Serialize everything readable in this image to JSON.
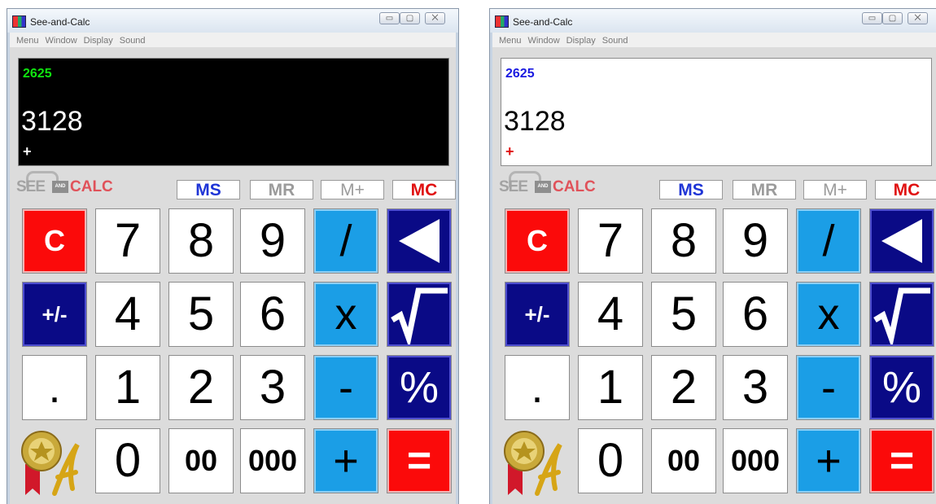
{
  "windows": [
    {
      "id": "dark-theme-window",
      "title": "See-and-Calc",
      "display_theme": "dark",
      "menu": [
        "Menu",
        "Window",
        "Display",
        "Sound"
      ],
      "display": {
        "previous_value": "2625",
        "current_value": "3128",
        "operator": "+"
      }
    },
    {
      "id": "light-theme-window",
      "title": "See-and-Calc",
      "display_theme": "light",
      "menu": [
        "Menu",
        "Window",
        "Display",
        "Sound"
      ],
      "display": {
        "previous_value": "2625",
        "current_value": "3128",
        "operator": "+"
      }
    }
  ],
  "window_controls": {
    "minimize": "▭",
    "maximize": "▢",
    "close": "⨉"
  },
  "logo": {
    "see": "SEE",
    "and": "AND",
    "calc": "CALC"
  },
  "memory_keys": [
    "MS",
    "MR",
    "M+",
    "MC"
  ],
  "keys": [
    [
      "C",
      "7",
      "8",
      "9",
      "/",
      "backspace-icon"
    ],
    [
      "+/-",
      "4",
      "5",
      "6",
      "x",
      "sqrt-icon"
    ],
    [
      ".",
      "1",
      "2",
      "3",
      "-",
      "%"
    ],
    [
      "award-icon",
      "0",
      "00",
      "000",
      "+",
      "="
    ]
  ],
  "colors": {
    "red": "#fb0a0a",
    "navy": "#0a0a86",
    "blue": "#1b9ee6",
    "dark_display_bg": "#000000",
    "light_display_bg": "#ffffff",
    "previous_value_dark": "#10e510",
    "previous_value_light": "#1a1ae0",
    "ms_label": "#1f35d6",
    "mc_label": "#e01212"
  }
}
